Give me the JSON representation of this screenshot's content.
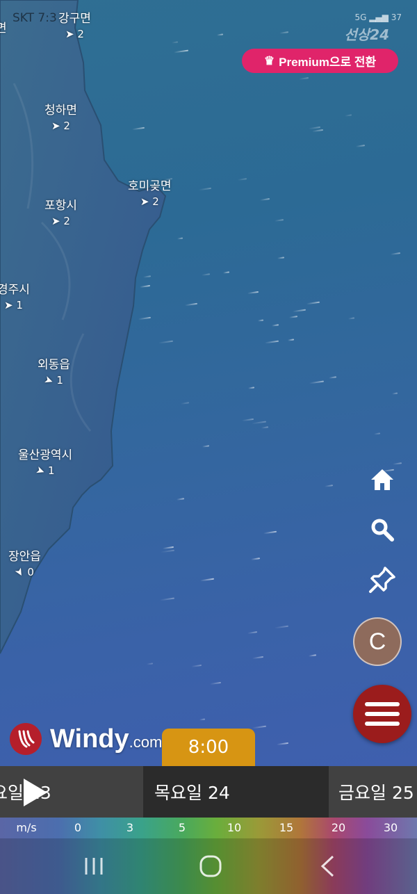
{
  "status": {
    "carrier_time": "SKT 7:3",
    "brand": "선상24",
    "battery": "37",
    "network": "5G"
  },
  "premium": {
    "label": "Premium으로 전환",
    "icon": "crown-icon"
  },
  "cities": [
    {
      "name": "강구면",
      "wind": "2"
    },
    {
      "name": "청하면",
      "wind": "2"
    },
    {
      "name": "호미곶면",
      "wind": "2"
    },
    {
      "name": "포항시",
      "wind": "2"
    },
    {
      "name": "경주시",
      "wind": "1"
    },
    {
      "name": "외동읍",
      "wind": "1"
    },
    {
      "name": "울산광역시",
      "wind": "1"
    },
    {
      "name": "장안읍",
      "wind": "0"
    },
    {
      "name": "면",
      "wind": ""
    }
  ],
  "side_icons": {
    "home": "home-icon",
    "search": "search-icon",
    "pin": "pin-icon"
  },
  "avatar": {
    "initial": "C"
  },
  "logo": {
    "name": "Windy",
    "suffix": ".com"
  },
  "timeline": {
    "current_time": "8:00",
    "days": [
      "요일 23",
      "목요일 24",
      "금요일 25"
    ]
  },
  "scale": {
    "unit": "m/s",
    "ticks": [
      "0",
      "3",
      "5",
      "10",
      "15",
      "20",
      "30"
    ]
  },
  "colors": {
    "premium": "#e0246a",
    "time_bubble": "#d79513",
    "menu_button": "#9b1c1c",
    "avatar": "#8e6b5c"
  }
}
